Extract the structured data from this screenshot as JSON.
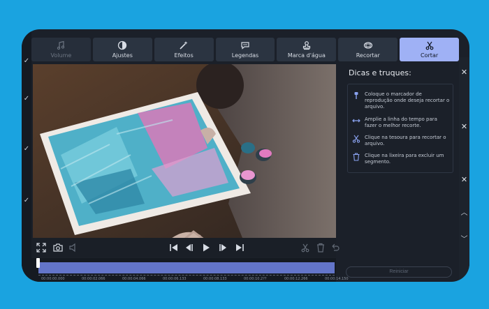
{
  "toolbar": {
    "tabs": [
      {
        "label": "Volume",
        "icon": "music-note-icon",
        "state": "dim"
      },
      {
        "label": "Ajustes",
        "icon": "contrast-icon",
        "state": "normal"
      },
      {
        "label": "Efeitos",
        "icon": "magic-wand-icon",
        "state": "normal"
      },
      {
        "label": "Legendas",
        "icon": "speech-bubble-icon",
        "state": "normal"
      },
      {
        "label": "Marca d'água",
        "icon": "stamp-icon",
        "state": "normal"
      },
      {
        "label": "Recortar",
        "icon": "crop-icon",
        "state": "normal"
      },
      {
        "label": "Cortar",
        "icon": "scissors-icon",
        "state": "active"
      }
    ]
  },
  "tips": {
    "title": "Dicas e truques:",
    "items": [
      {
        "icon": "playhead-marker-icon",
        "text": "Coloque o marcador de reprodução onde deseja recortar o arquivo."
      },
      {
        "icon": "zoom-timeline-icon",
        "text": "Amplie a linha do tempo para fazer o melhor recorte."
      },
      {
        "icon": "scissors-icon",
        "text": "Clique na tesoura para recortar o arquivo."
      },
      {
        "icon": "trash-icon",
        "text": "Clique na lixeira para excluir um segmento."
      }
    ],
    "reset_label": "Reiniciar"
  },
  "timeline": {
    "ticks": [
      "00:00:00.000",
      "00:00:02.066",
      "00:00:04.066",
      "00:00:06.133",
      "00:00:08.133",
      "00:00:10.2??",
      "00:00:12.266",
      "00:00:14.150"
    ]
  },
  "colors": {
    "accent": "#9fb1f5",
    "track": "#6375c9",
    "background": "#1aa3e0"
  }
}
